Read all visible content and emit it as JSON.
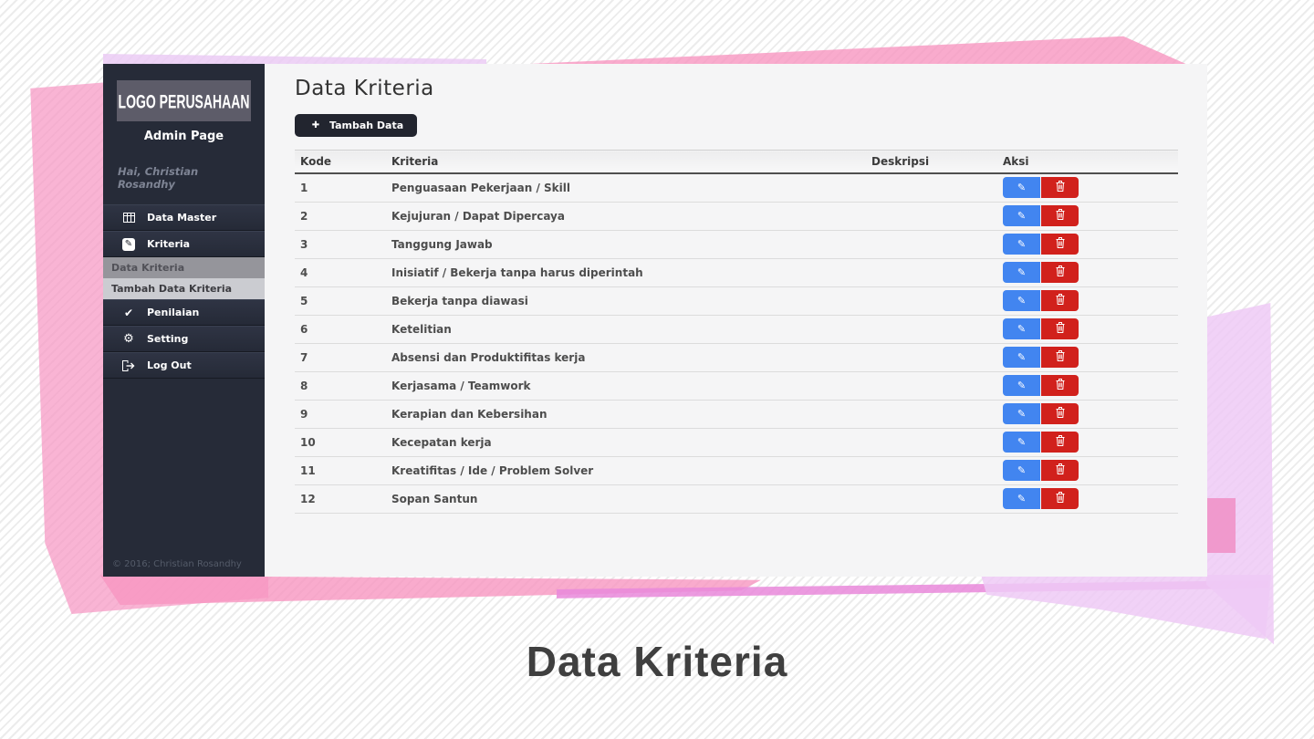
{
  "slide": {
    "caption": "Data Kriteria"
  },
  "sidebar": {
    "logo": "LOGO PERUSAHAAN",
    "subtitle": "Admin Page",
    "greeting": "Hai, Christian Rosandhy",
    "menu": [
      {
        "label": "Data Master",
        "icon": "table-grid-icon",
        "type": "item"
      },
      {
        "label": "Kriteria",
        "icon": "pencil-square-icon",
        "type": "item"
      },
      {
        "label": "Data Kriteria",
        "type": "subitem-active"
      },
      {
        "label": "Tambah Data Kriteria",
        "type": "subitem"
      },
      {
        "label": "Penilaian",
        "icon": "check-icon",
        "type": "item"
      },
      {
        "label": "Setting",
        "icon": "gear-icon",
        "type": "item"
      },
      {
        "label": "Log Out",
        "icon": "sign-out-icon",
        "type": "item"
      }
    ],
    "footer": "© 2016; Christian Rosandhy"
  },
  "main": {
    "heading": "Data Kriteria",
    "add_button": {
      "label": "Tambah Data",
      "icon": "plus-icon"
    },
    "table": {
      "headers": [
        "Kode",
        "Kriteria",
        "Deskripsi",
        "Aksi"
      ],
      "rows": [
        {
          "kode": "1",
          "kriteria": "Penguasaan Pekerjaan / Skill",
          "deskripsi": ""
        },
        {
          "kode": "2",
          "kriteria": "Kejujuran / Dapat Dipercaya",
          "deskripsi": ""
        },
        {
          "kode": "3",
          "kriteria": "Tanggung Jawab",
          "deskripsi": ""
        },
        {
          "kode": "4",
          "kriteria": "Inisiatif / Bekerja tanpa harus diperintah",
          "deskripsi": ""
        },
        {
          "kode": "5",
          "kriteria": "Bekerja tanpa diawasi",
          "deskripsi": ""
        },
        {
          "kode": "6",
          "kriteria": "Ketelitian",
          "deskripsi": ""
        },
        {
          "kode": "7",
          "kriteria": "Absensi dan Produktifitas kerja",
          "deskripsi": ""
        },
        {
          "kode": "8",
          "kriteria": "Kerjasama / Teamwork",
          "deskripsi": ""
        },
        {
          "kode": "9",
          "kriteria": "Kerapian dan Kebersihan",
          "deskripsi": ""
        },
        {
          "kode": "10",
          "kriteria": "Kecepatan kerja",
          "deskripsi": ""
        },
        {
          "kode": "11",
          "kriteria": "Kreatifitas / Ide / Problem Solver",
          "deskripsi": ""
        },
        {
          "kode": "12",
          "kriteria": "Sopan Santun",
          "deskripsi": ""
        }
      ],
      "actions": [
        {
          "name": "edit",
          "icon": "pencil-icon",
          "color": "#4285f0"
        },
        {
          "name": "delete",
          "icon": "trash-icon",
          "color": "#d1211c"
        }
      ]
    }
  },
  "colors": {
    "sidebar_bg": "#262b38",
    "button_dark": "#22252f",
    "edit_blue": "#4285f0",
    "delete_red": "#d1211c",
    "accent_pink": "#f796c0",
    "accent_lavender": "#ecccf5",
    "accent_magenta": "#e988db"
  }
}
